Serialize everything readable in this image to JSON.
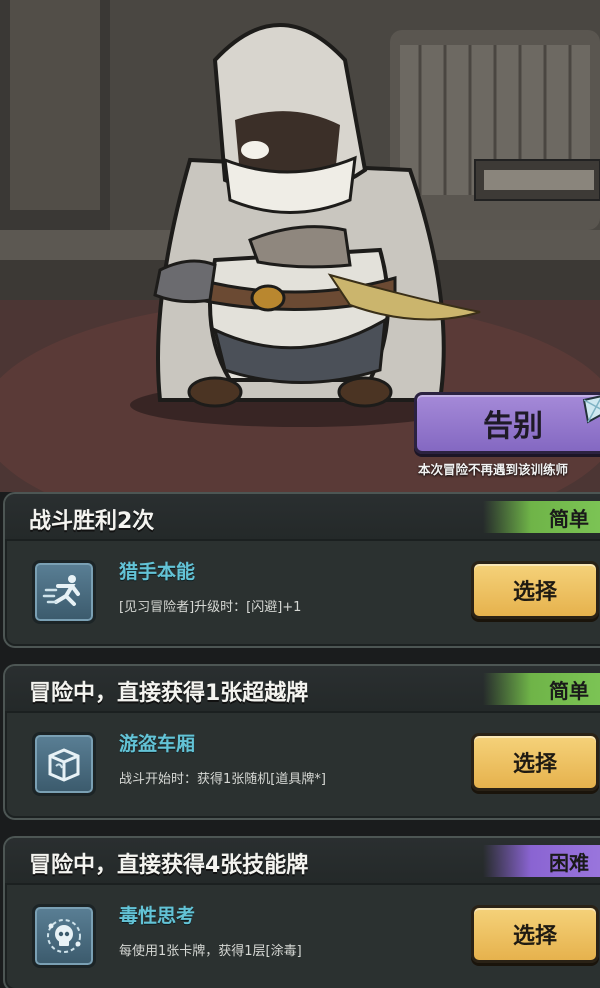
{
  "scene": {
    "character": "assassin-character",
    "farewell_button": "告别",
    "farewell_note": "本次冒险不再遇到该训练师"
  },
  "options": [
    {
      "title": "战斗胜利2次",
      "difficulty": "简单",
      "difficulty_color": "#6fb448",
      "icon": "dash-runner-icon",
      "skill_name": "猎手本能",
      "skill_desc": "[见习冒险者]升级时：[闪避]+1",
      "select_label": "选择"
    },
    {
      "title": "冒险中，直接获得1张超越牌",
      "difficulty": "简单",
      "difficulty_color": "#6fb448",
      "icon": "treasure-box-icon",
      "skill_name": "游盗车厢",
      "skill_desc": "战斗开始时：获得1张随机[道具牌*]",
      "select_label": "选择"
    },
    {
      "title": "冒险中，直接获得4张技能牌",
      "difficulty": "困难",
      "difficulty_color": "#8a64d2",
      "icon": "poison-skull-icon",
      "skill_name": "毒性思考",
      "skill_desc": "每使用1张卡牌，获得1层[涂毒]",
      "select_label": "选择"
    }
  ],
  "colors": {
    "skill_name": "#63c3d6",
    "select_button": "#f0c463",
    "farewell_button": "#8f74cc"
  }
}
